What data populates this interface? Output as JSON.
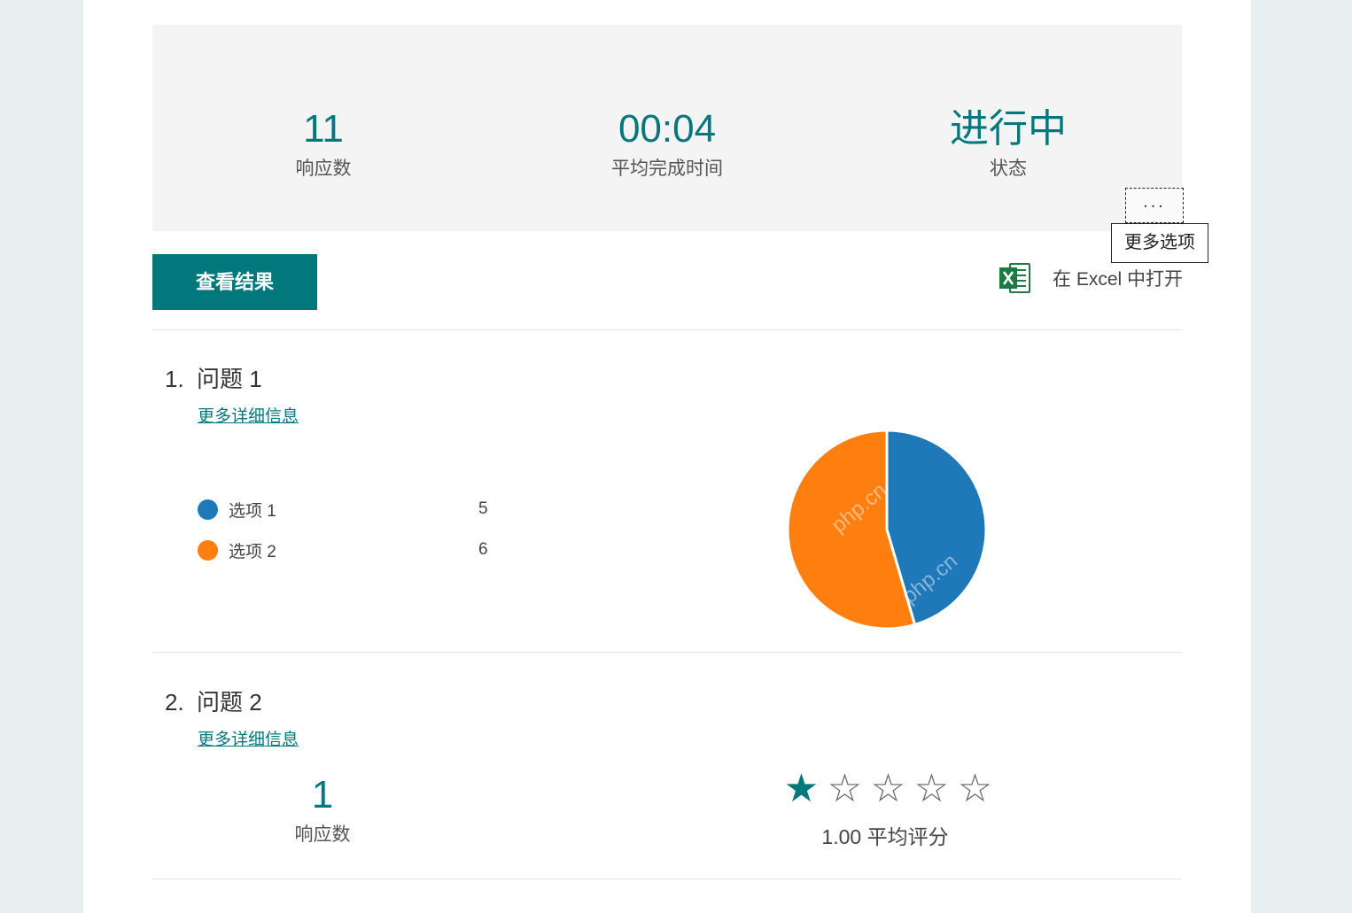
{
  "summary": {
    "responses": {
      "value": "11",
      "label": "响应数"
    },
    "avg_time": {
      "value": "00:04",
      "label": "平均完成时间"
    },
    "status": {
      "value": "进行中",
      "label": "状态"
    }
  },
  "more_options": {
    "glyph": "...",
    "tooltip": "更多选项"
  },
  "toolbar": {
    "view_results_label": "查看结果",
    "excel_label": "在 Excel 中打开",
    "excel_icon": "excel-icon"
  },
  "questions": [
    {
      "number": "1.",
      "title": "问题 1",
      "details_link": "更多详细信息",
      "options": [
        {
          "label": "选项 1",
          "count": "5",
          "color": "#1f78b8"
        },
        {
          "label": "选项 2",
          "count": "6",
          "color": "#fe7f10"
        }
      ]
    },
    {
      "number": "2.",
      "title": "问题 2",
      "details_link": "更多详细信息",
      "responses": {
        "value": "1",
        "label": "响应数"
      },
      "rating": {
        "filled": 1,
        "total": 5,
        "text": "1.00 平均评分"
      }
    }
  ],
  "watermark_text": "php.cn",
  "colors": {
    "accent": "#03787c",
    "blue": "#1f78b8",
    "orange": "#fe7f10"
  }
}
